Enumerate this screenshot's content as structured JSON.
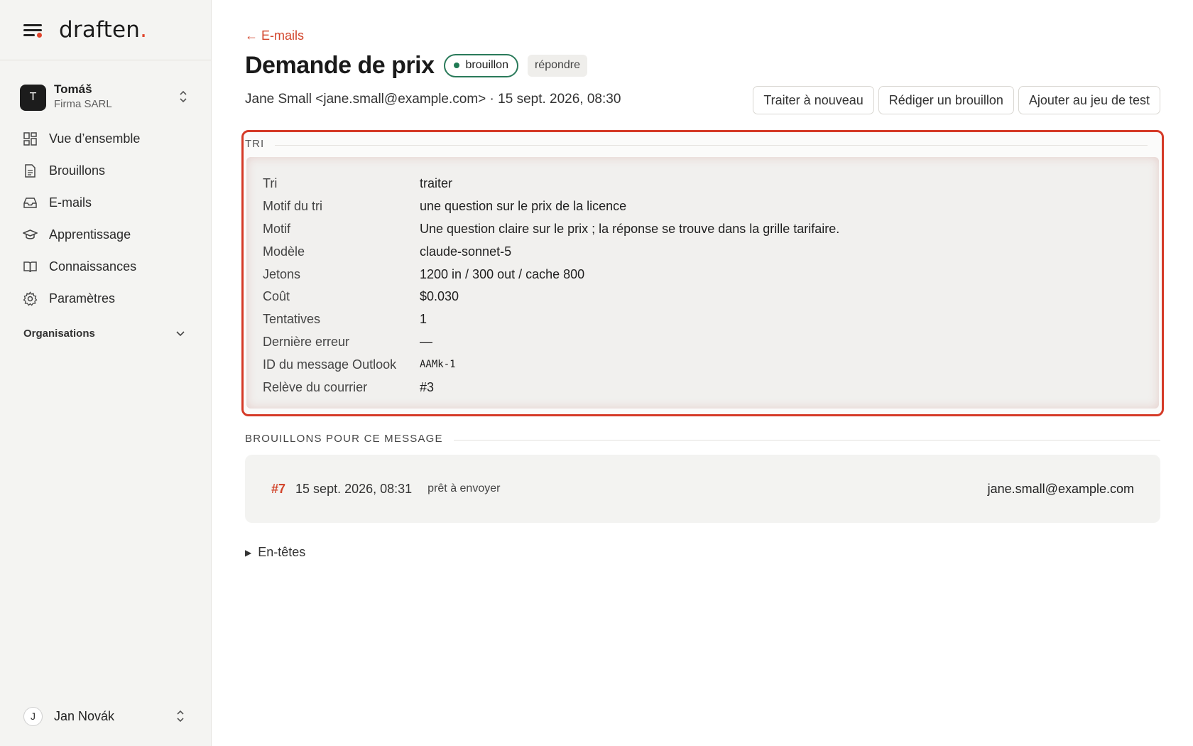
{
  "brand": {
    "name": "draften",
    "accent_char": "."
  },
  "workspace": {
    "initial": "T",
    "name": "Tomáš",
    "company": "Firma SARL"
  },
  "nav": [
    {
      "label": "Vue d’ensemble",
      "icon": "dashboard-icon"
    },
    {
      "label": "Brouillons",
      "icon": "document-icon"
    },
    {
      "label": "E-mails",
      "icon": "inbox-icon"
    },
    {
      "label": "Apprentissage",
      "icon": "graduation-cap-icon"
    },
    {
      "label": "Connaissances",
      "icon": "book-icon"
    },
    {
      "label": "Paramètres",
      "icon": "gear-icon"
    }
  ],
  "organisations_label": "Organisations",
  "user": {
    "initial": "J",
    "name": "Jan Novák"
  },
  "header": {
    "back_label": "← E-mails",
    "title": "Demande de prix",
    "status_badge": "brouillon",
    "type_badge": "répondre",
    "meta": "Jane Small <jane.small@example.com> · 15 sept. 2026, 08:30"
  },
  "actions": {
    "reprocess": "Traiter à nouveau",
    "draft": "Rédiger un brouillon",
    "add_test": "Ajouter au jeu de test"
  },
  "tri": {
    "section_label": "TRI",
    "rows": [
      {
        "key": "Tri",
        "value": "traiter"
      },
      {
        "key": "Motif du tri",
        "value": "une question sur le prix de la licence"
      },
      {
        "key": "Motif",
        "value": "Une question claire sur le prix ; la réponse se trouve dans la grille tarifaire."
      },
      {
        "key": "Modèle",
        "value": "claude-sonnet-5"
      },
      {
        "key": "Jetons",
        "value": "1200 in / 300 out / cache 800"
      },
      {
        "key": "Coût",
        "value": "$0.030"
      },
      {
        "key": "Tentatives",
        "value": "1"
      },
      {
        "key": "Dernière erreur",
        "value": "—"
      },
      {
        "key": "ID du message Outlook",
        "value": "AAMk-1"
      },
      {
        "key": "Relève du courrier",
        "value": "#3"
      }
    ]
  },
  "drafts": {
    "section_label": "BROUILLONS POUR CE MESSAGE",
    "items": [
      {
        "num": "#7",
        "date": "15 sept. 2026, 08:31",
        "status": "prêt à envoyer",
        "email": "jane.small@example.com"
      }
    ]
  },
  "headers_toggle": "En-têtes",
  "colors": {
    "accent": "#d2452c",
    "status_green": "#1f7a53",
    "highlight_border": "#d53a27"
  }
}
